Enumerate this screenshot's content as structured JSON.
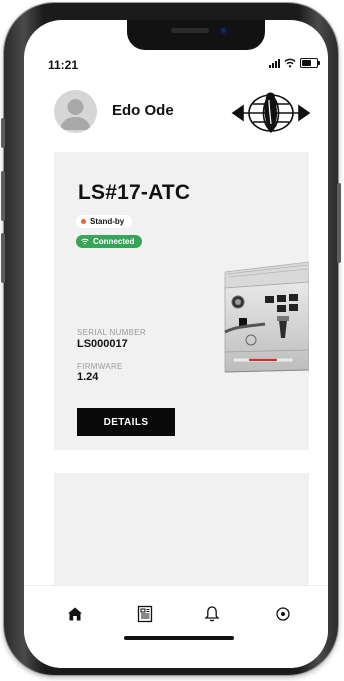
{
  "status_bar": {
    "time": "11:21",
    "battery_level": 0.75
  },
  "header": {
    "user_name": "Edo Ode",
    "avatar_icon": "user-avatar-icon",
    "brand_logo": "globe-logo"
  },
  "machine_card": {
    "machine_name": "LS#17-ATC",
    "state_label": "Stand-by",
    "connection_label": "Connected",
    "serial_label": "SERIAL NUMBER",
    "serial_value": "LS000017",
    "firmware_label": "FIRMWARE",
    "firmware_value": "1.24",
    "details_button": "DETAILS",
    "status_colors": {
      "standby_dot": "#e26a3c",
      "connected_bg": "#3aa35a"
    }
  },
  "tab_bar": {
    "tabs": [
      {
        "icon": "home-icon",
        "active": true
      },
      {
        "icon": "menu-book-icon",
        "active": false
      },
      {
        "icon": "bell-icon",
        "active": false
      },
      {
        "icon": "location-icon",
        "active": false
      }
    ]
  }
}
